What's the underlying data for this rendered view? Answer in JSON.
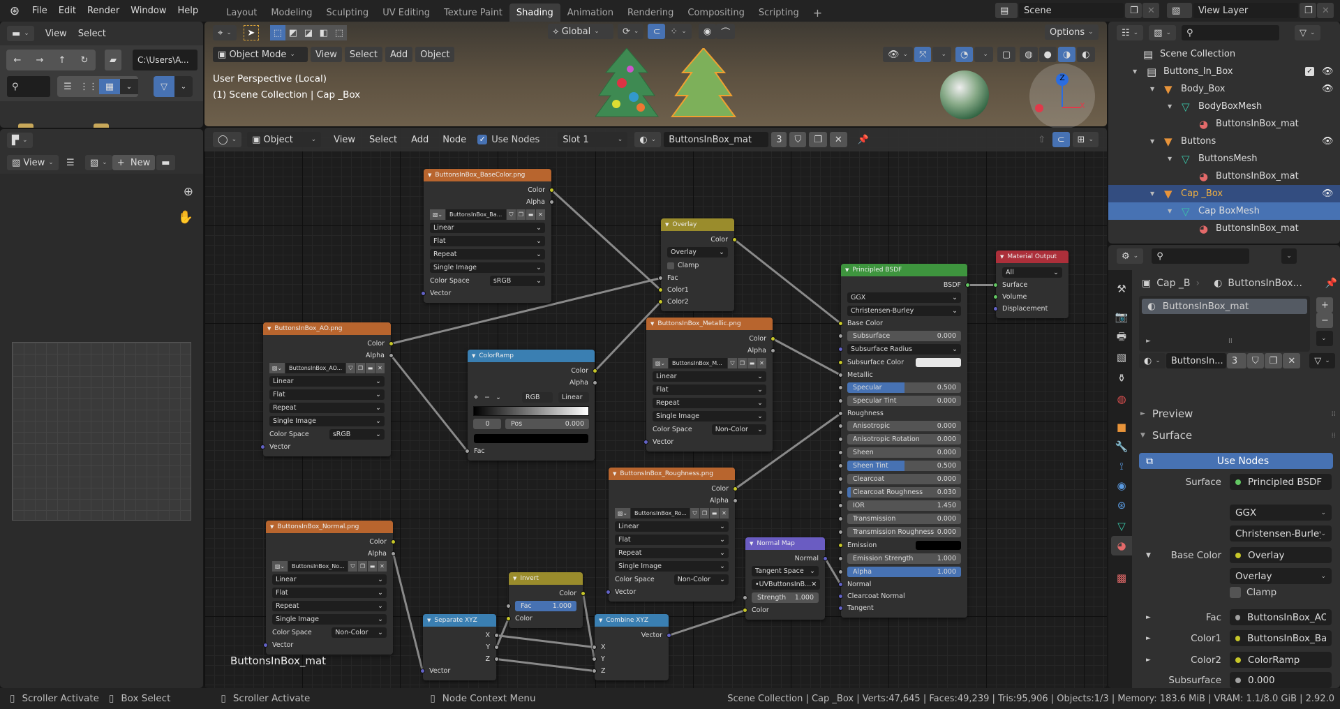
{
  "topbar": {
    "menus": [
      "File",
      "Edit",
      "Render",
      "Window",
      "Help"
    ],
    "workspaces": [
      "Layout",
      "Modeling",
      "Sculpting",
      "UV Editing",
      "Texture Paint",
      "Shading",
      "Animation",
      "Rendering",
      "Compositing",
      "Scripting"
    ],
    "active_workspace": "Shading",
    "add_tab": "+",
    "scene": "Scene",
    "view_layer": "View Layer"
  },
  "file_browser": {
    "menus": [
      "View",
      "Select"
    ],
    "path": "C:\\Users\\A..."
  },
  "image_editor": {
    "view": "View",
    "new": "New",
    "plus": "+"
  },
  "viewport": {
    "transform": "Global",
    "options": "Options",
    "mode": "Object Mode",
    "menus": [
      "View",
      "Select",
      "Add",
      "Object"
    ],
    "perspective": "User Perspective (Local)",
    "collection_info": "(1) Scene Collection | Cap _Box",
    "gizmo": {
      "z": "Z",
      "x": "X"
    }
  },
  "node_editor": {
    "object_type": "Object",
    "menus": [
      "View",
      "Select",
      "Add",
      "Node"
    ],
    "use_nodes": "Use Nodes",
    "use_nodes_checked": true,
    "slot": "Slot 1",
    "material": "ButtonsInBox_mat",
    "users": "3",
    "tree_label": "ButtonsInBox_mat"
  },
  "colors": {
    "image": "#b8652e",
    "converter": "#3a7fb2",
    "color": "#9a8c2c",
    "shader": "#3e953e",
    "output": "#ac2f3a",
    "vector": "#6a5cc2",
    "sock_color": "#c7c729",
    "sock_float": "#a1a1a1",
    "sock_vector": "#6363c7",
    "sock_shader": "#63c763",
    "accent": "#4772b3"
  },
  "nodes": [
    {
      "id": "basecolor",
      "title": "ButtonsInBox_BaseColor.png",
      "cat": "image",
      "rows": [
        {
          "t": "out",
          "label": "Color",
          "s": "color"
        },
        {
          "t": "out",
          "label": "Alpha",
          "s": "float"
        },
        {
          "t": "img",
          "value": "ButtonsInBox_Ba..."
        },
        {
          "t": "dd",
          "value": "Linear"
        },
        {
          "t": "dd",
          "value": "Flat"
        },
        {
          "t": "dd",
          "value": "Repeat"
        },
        {
          "t": "dd",
          "value": "Single Image"
        },
        {
          "t": "csel",
          "label": "Color Space",
          "value": "sRGB"
        },
        {
          "t": "in",
          "label": "Vector",
          "s": "vector"
        }
      ]
    },
    {
      "id": "ao",
      "title": "ButtonsInBox_AO.png",
      "cat": "image",
      "rows": [
        {
          "t": "out",
          "label": "Color",
          "s": "color"
        },
        {
          "t": "out",
          "label": "Alpha",
          "s": "float"
        },
        {
          "t": "img",
          "value": "ButtonsInBox_AO..."
        },
        {
          "t": "dd",
          "value": "Linear"
        },
        {
          "t": "dd",
          "value": "Flat"
        },
        {
          "t": "dd",
          "value": "Repeat"
        },
        {
          "t": "dd",
          "value": "Single Image"
        },
        {
          "t": "csel",
          "label": "Color Space",
          "value": "sRGB"
        },
        {
          "t": "in",
          "label": "Vector",
          "s": "vector"
        }
      ]
    },
    {
      "id": "ramp",
      "title": "ColorRamp",
      "cat": "converter",
      "rows": [
        {
          "t": "out",
          "label": "Color",
          "s": "color"
        },
        {
          "t": "out",
          "label": "Alpha",
          "s": "float"
        },
        {
          "t": "ramp",
          "mode": "RGB",
          "interp": "Linear",
          "index": "0",
          "pos_label": "Pos",
          "pos": "0.000",
          "plus": "+",
          "minus": "−"
        },
        {
          "t": "swatch",
          "color": "#000000",
          "full": true
        },
        {
          "t": "in",
          "label": "Fac",
          "s": "float"
        }
      ]
    },
    {
      "id": "overlay",
      "title": "Overlay",
      "cat": "color",
      "rows": [
        {
          "t": "out",
          "label": "Color",
          "s": "color"
        },
        {
          "t": "dd",
          "value": "Overlay"
        },
        {
          "t": "check",
          "label": "Clamp",
          "checked": false
        },
        {
          "t": "in",
          "label": "Fac",
          "s": "float"
        },
        {
          "t": "in",
          "label": "Color1",
          "s": "color"
        },
        {
          "t": "in",
          "label": "Color2",
          "s": "color"
        }
      ]
    },
    {
      "id": "metallic",
      "title": "ButtonsInBox_Metallic.png",
      "cat": "image",
      "rows": [
        {
          "t": "out",
          "label": "Color",
          "s": "color"
        },
        {
          "t": "out",
          "label": "Alpha",
          "s": "float"
        },
        {
          "t": "img",
          "value": "ButtonsInBox_M..."
        },
        {
          "t": "dd",
          "value": "Linear"
        },
        {
          "t": "dd",
          "value": "Flat"
        },
        {
          "t": "dd",
          "value": "Repeat"
        },
        {
          "t": "dd",
          "value": "Single Image"
        },
        {
          "t": "csel",
          "label": "Color Space",
          "value": "Non-Color"
        },
        {
          "t": "in",
          "label": "Vector",
          "s": "vector"
        }
      ]
    },
    {
      "id": "rough",
      "title": "ButtonsInBox_Roughness.png",
      "cat": "image",
      "rows": [
        {
          "t": "out",
          "label": "Color",
          "s": "color"
        },
        {
          "t": "out",
          "label": "Alpha",
          "s": "float"
        },
        {
          "t": "img",
          "value": "ButtonsInBox_Ro..."
        },
        {
          "t": "dd",
          "value": "Linear"
        },
        {
          "t": "dd",
          "value": "Flat"
        },
        {
          "t": "dd",
          "value": "Repeat"
        },
        {
          "t": "dd",
          "value": "Single Image"
        },
        {
          "t": "csel",
          "label": "Color Space",
          "value": "Non-Color"
        },
        {
          "t": "in",
          "label": "Vector",
          "s": "vector"
        }
      ]
    },
    {
      "id": "normal",
      "title": "ButtonsInBox_Normal.png",
      "cat": "image",
      "rows": [
        {
          "t": "out",
          "label": "Color",
          "s": "color"
        },
        {
          "t": "out",
          "label": "Alpha",
          "s": "float"
        },
        {
          "t": "img",
          "value": "ButtonsInBox_No..."
        },
        {
          "t": "dd",
          "value": "Linear"
        },
        {
          "t": "dd",
          "value": "Flat"
        },
        {
          "t": "dd",
          "value": "Repeat"
        },
        {
          "t": "dd",
          "value": "Single Image"
        },
        {
          "t": "csel",
          "label": "Color Space",
          "value": "Non-Color"
        },
        {
          "t": "in",
          "label": "Vector",
          "s": "vector"
        }
      ]
    },
    {
      "id": "invert",
      "title": "Invert",
      "cat": "color",
      "rows": [
        {
          "t": "out",
          "label": "Color",
          "s": "color"
        },
        {
          "t": "field",
          "label": "Fac",
          "value": "1.000",
          "fill": 1,
          "s": "float"
        },
        {
          "t": "in",
          "label": "Color",
          "s": "color"
        }
      ]
    },
    {
      "id": "sep",
      "title": "Separate XYZ",
      "cat": "converter",
      "rows": [
        {
          "t": "out",
          "label": "X",
          "s": "float"
        },
        {
          "t": "out",
          "label": "Y",
          "s": "float"
        },
        {
          "t": "out",
          "label": "Z",
          "s": "float"
        },
        {
          "t": "in",
          "label": "Vector",
          "s": "vector"
        }
      ]
    },
    {
      "id": "comb",
      "title": "Combine XYZ",
      "cat": "converter",
      "rows": [
        {
          "t": "out",
          "label": "Vector",
          "s": "vector"
        },
        {
          "t": "in",
          "label": "X",
          "s": "float"
        },
        {
          "t": "in",
          "label": "Y",
          "s": "float"
        },
        {
          "t": "in",
          "label": "Z",
          "s": "float"
        }
      ]
    },
    {
      "id": "nmap",
      "title": "Normal Map",
      "cat": "vector",
      "rows": [
        {
          "t": "out",
          "label": "Normal",
          "s": "vector"
        },
        {
          "t": "dd",
          "value": "Tangent Space"
        },
        {
          "t": "uv",
          "value": "UVButtonsInB..."
        },
        {
          "t": "field",
          "label": "Strength",
          "value": "1.000",
          "s": "float"
        },
        {
          "t": "in",
          "label": "Color",
          "s": "color"
        }
      ]
    },
    {
      "id": "bsdf",
      "title": "Principled BSDF",
      "cat": "shader",
      "rows": [
        {
          "t": "out",
          "label": "BSDF",
          "s": "shader"
        },
        {
          "t": "dd",
          "value": "GGX"
        },
        {
          "t": "dd",
          "value": "Christensen-Burley"
        },
        {
          "t": "in",
          "label": "Base Color",
          "s": "color"
        },
        {
          "t": "field",
          "label": "Subsurface",
          "value": "0.000",
          "fill": 0,
          "s": "float"
        },
        {
          "t": "dd",
          "value": "Subsurface Radius",
          "s": "vector"
        },
        {
          "t": "swatch",
          "label": "Subsurface Color",
          "color": "#e8e8e8",
          "s": "color"
        },
        {
          "t": "in",
          "label": "Metallic",
          "s": "float"
        },
        {
          "t": "field",
          "label": "Specular",
          "value": "0.500",
          "fill": 0.5,
          "s": "float"
        },
        {
          "t": "field",
          "label": "Specular Tint",
          "value": "0.000",
          "fill": 0,
          "s": "float"
        },
        {
          "t": "in",
          "label": "Roughness",
          "s": "float"
        },
        {
          "t": "field",
          "label": "Anisotropic",
          "value": "0.000",
          "fill": 0,
          "s": "float"
        },
        {
          "t": "field",
          "label": "Anisotropic Rotation",
          "value": "0.000",
          "fill": 0,
          "s": "float"
        },
        {
          "t": "field",
          "label": "Sheen",
          "value": "0.000",
          "fill": 0,
          "s": "float"
        },
        {
          "t": "field",
          "label": "Sheen Tint",
          "value": "0.500",
          "fill": 0.5,
          "s": "float"
        },
        {
          "t": "field",
          "label": "Clearcoat",
          "value": "0.000",
          "fill": 0,
          "s": "float"
        },
        {
          "t": "field",
          "label": "Clearcoat Roughness",
          "value": "0.030",
          "fill": 0.03,
          "s": "float"
        },
        {
          "t": "field",
          "label": "IOR",
          "value": "1.450",
          "s": "float"
        },
        {
          "t": "field",
          "label": "Transmission",
          "value": "0.000",
          "fill": 0,
          "s": "float"
        },
        {
          "t": "field",
          "label": "Transmission Roughness",
          "value": "0.000",
          "fill": 0,
          "s": "float"
        },
        {
          "t": "swatch",
          "label": "Emission",
          "color": "#000000",
          "s": "color"
        },
        {
          "t": "field",
          "label": "Emission Strength",
          "value": "1.000",
          "s": "float"
        },
        {
          "t": "field",
          "label": "Alpha",
          "value": "1.000",
          "fill": 1,
          "s": "float"
        },
        {
          "t": "in",
          "label": "Normal",
          "s": "vector"
        },
        {
          "t": "in",
          "label": "Clearcoat Normal",
          "s": "vector"
        },
        {
          "t": "in",
          "label": "Tangent",
          "s": "vector"
        }
      ]
    },
    {
      "id": "out",
      "title": "Material Output",
      "cat": "output",
      "rows": [
        {
          "t": "dd",
          "value": "All"
        },
        {
          "t": "in",
          "label": "Surface",
          "s": "shader"
        },
        {
          "t": "in",
          "label": "Volume",
          "s": "shader"
        },
        {
          "t": "in",
          "label": "Displacement",
          "s": "vector"
        }
      ]
    }
  ],
  "links": [
    {
      "from": [
        "basecolor",
        0
      ],
      "to": [
        "overlay",
        4
      ]
    },
    {
      "from": [
        "ao",
        0
      ],
      "to": [
        "overlay",
        3
      ]
    },
    {
      "from": [
        "ao",
        1
      ],
      "to": [
        "ramp",
        4
      ]
    },
    {
      "from": [
        "ramp",
        0
      ],
      "to": [
        "overlay",
        5
      ]
    },
    {
      "from": [
        "overlay",
        0
      ],
      "to": [
        "bsdf",
        3
      ]
    },
    {
      "from": [
        "metallic",
        0
      ],
      "to": [
        "bsdf",
        7
      ]
    },
    {
      "from": [
        "rough",
        0
      ],
      "to": [
        "bsdf",
        10
      ]
    },
    {
      "from": [
        "normal",
        1
      ],
      "to": [
        "sep",
        3
      ]
    },
    {
      "from": [
        "sep",
        0
      ],
      "to": [
        "comb",
        1
      ]
    },
    {
      "from": [
        "sep",
        1
      ],
      "to": [
        "invert",
        2
      ]
    },
    {
      "from": [
        "sep",
        2
      ],
      "to": [
        "comb",
        3
      ]
    },
    {
      "from": [
        "invert",
        0
      ],
      "to": [
        "comb",
        2
      ]
    },
    {
      "from": [
        "comb",
        0
      ],
      "to": [
        "nmap",
        4
      ]
    },
    {
      "from": [
        "nmap",
        0
      ],
      "to": [
        "bsdf",
        23
      ]
    },
    {
      "from": [
        "bsdf",
        0
      ],
      "to": [
        "out",
        1
      ]
    }
  ],
  "outliner": {
    "items": [
      {
        "label": "Scene Collection",
        "icon": "collection",
        "depth": 0
      },
      {
        "label": "Buttons_In_Box",
        "icon": "collection",
        "depth": 1,
        "check": true,
        "eye": true
      },
      {
        "label": "Body_Box",
        "icon": "object",
        "depth": 2,
        "eye": true
      },
      {
        "label": "BodyBoxMesh",
        "icon": "mesh",
        "depth": 3
      },
      {
        "label": "ButtonsInBox_mat",
        "icon": "material",
        "depth": 4
      },
      {
        "label": "Buttons",
        "icon": "object",
        "depth": 2,
        "eye": true
      },
      {
        "label": "ButtonsMesh",
        "icon": "mesh",
        "depth": 3
      },
      {
        "label": "ButtonsInBox_mat",
        "icon": "material",
        "depth": 4
      },
      {
        "label": "Cap _Box",
        "icon": "object",
        "depth": 2,
        "eye": true,
        "state": "sel"
      },
      {
        "label": "Cap BoxMesh",
        "icon": "mesh",
        "depth": 3,
        "state": "act"
      },
      {
        "label": "ButtonsInBox_mat",
        "icon": "material",
        "depth": 4
      }
    ]
  },
  "properties": {
    "breadcrumb_object": "Cap _B",
    "breadcrumb_material": "ButtonsInBox...",
    "slot_item": "ButtonsInBox_mat",
    "material_name": "ButtonsIn...",
    "users": "3",
    "preview": "Preview",
    "surface_panel": "Surface",
    "use_nodes": "Use Nodes",
    "rows": [
      {
        "label": "Surface",
        "value": "Principled BSDF",
        "dot": "#63c763"
      },
      {
        "label": "",
        "value": "GGX",
        "dropdown": true
      },
      {
        "label": "",
        "value": "Christensen-Burley",
        "dropdown": true
      },
      {
        "label": "Base Color",
        "value": "Overlay",
        "dot": "#c7c729",
        "expand": "▼"
      },
      {
        "label": "",
        "value": "Overlay",
        "dropdown": true
      },
      {
        "label": "",
        "value": "Clamp",
        "checkbox": true
      },
      {
        "label": "Fac",
        "value": "ButtonsInBox_AO...",
        "dot": "#a1a1a1",
        "expand": "►"
      },
      {
        "label": "Color1",
        "value": "ButtonsInBox_Ba...",
        "dot": "#c7c729",
        "expand": "►"
      },
      {
        "label": "Color2",
        "value": "ColorRamp",
        "dot": "#c7c729",
        "expand": "►"
      },
      {
        "label": "Subsurface",
        "value": "0.000",
        "dot": "#a1a1a1"
      }
    ]
  },
  "status": {
    "left": [
      "Scroller Activate",
      "Box Select",
      "Scroller Activate",
      "Node Context Menu"
    ],
    "right": "Scene Collection | Cap _Box | Verts:47,645 | Faces:49,239 | Tris:95,906 | Objects:1/3 | Memory: 183.6 MiB | VRAM: 1.1/8.0 GiB | 2.92.0"
  }
}
